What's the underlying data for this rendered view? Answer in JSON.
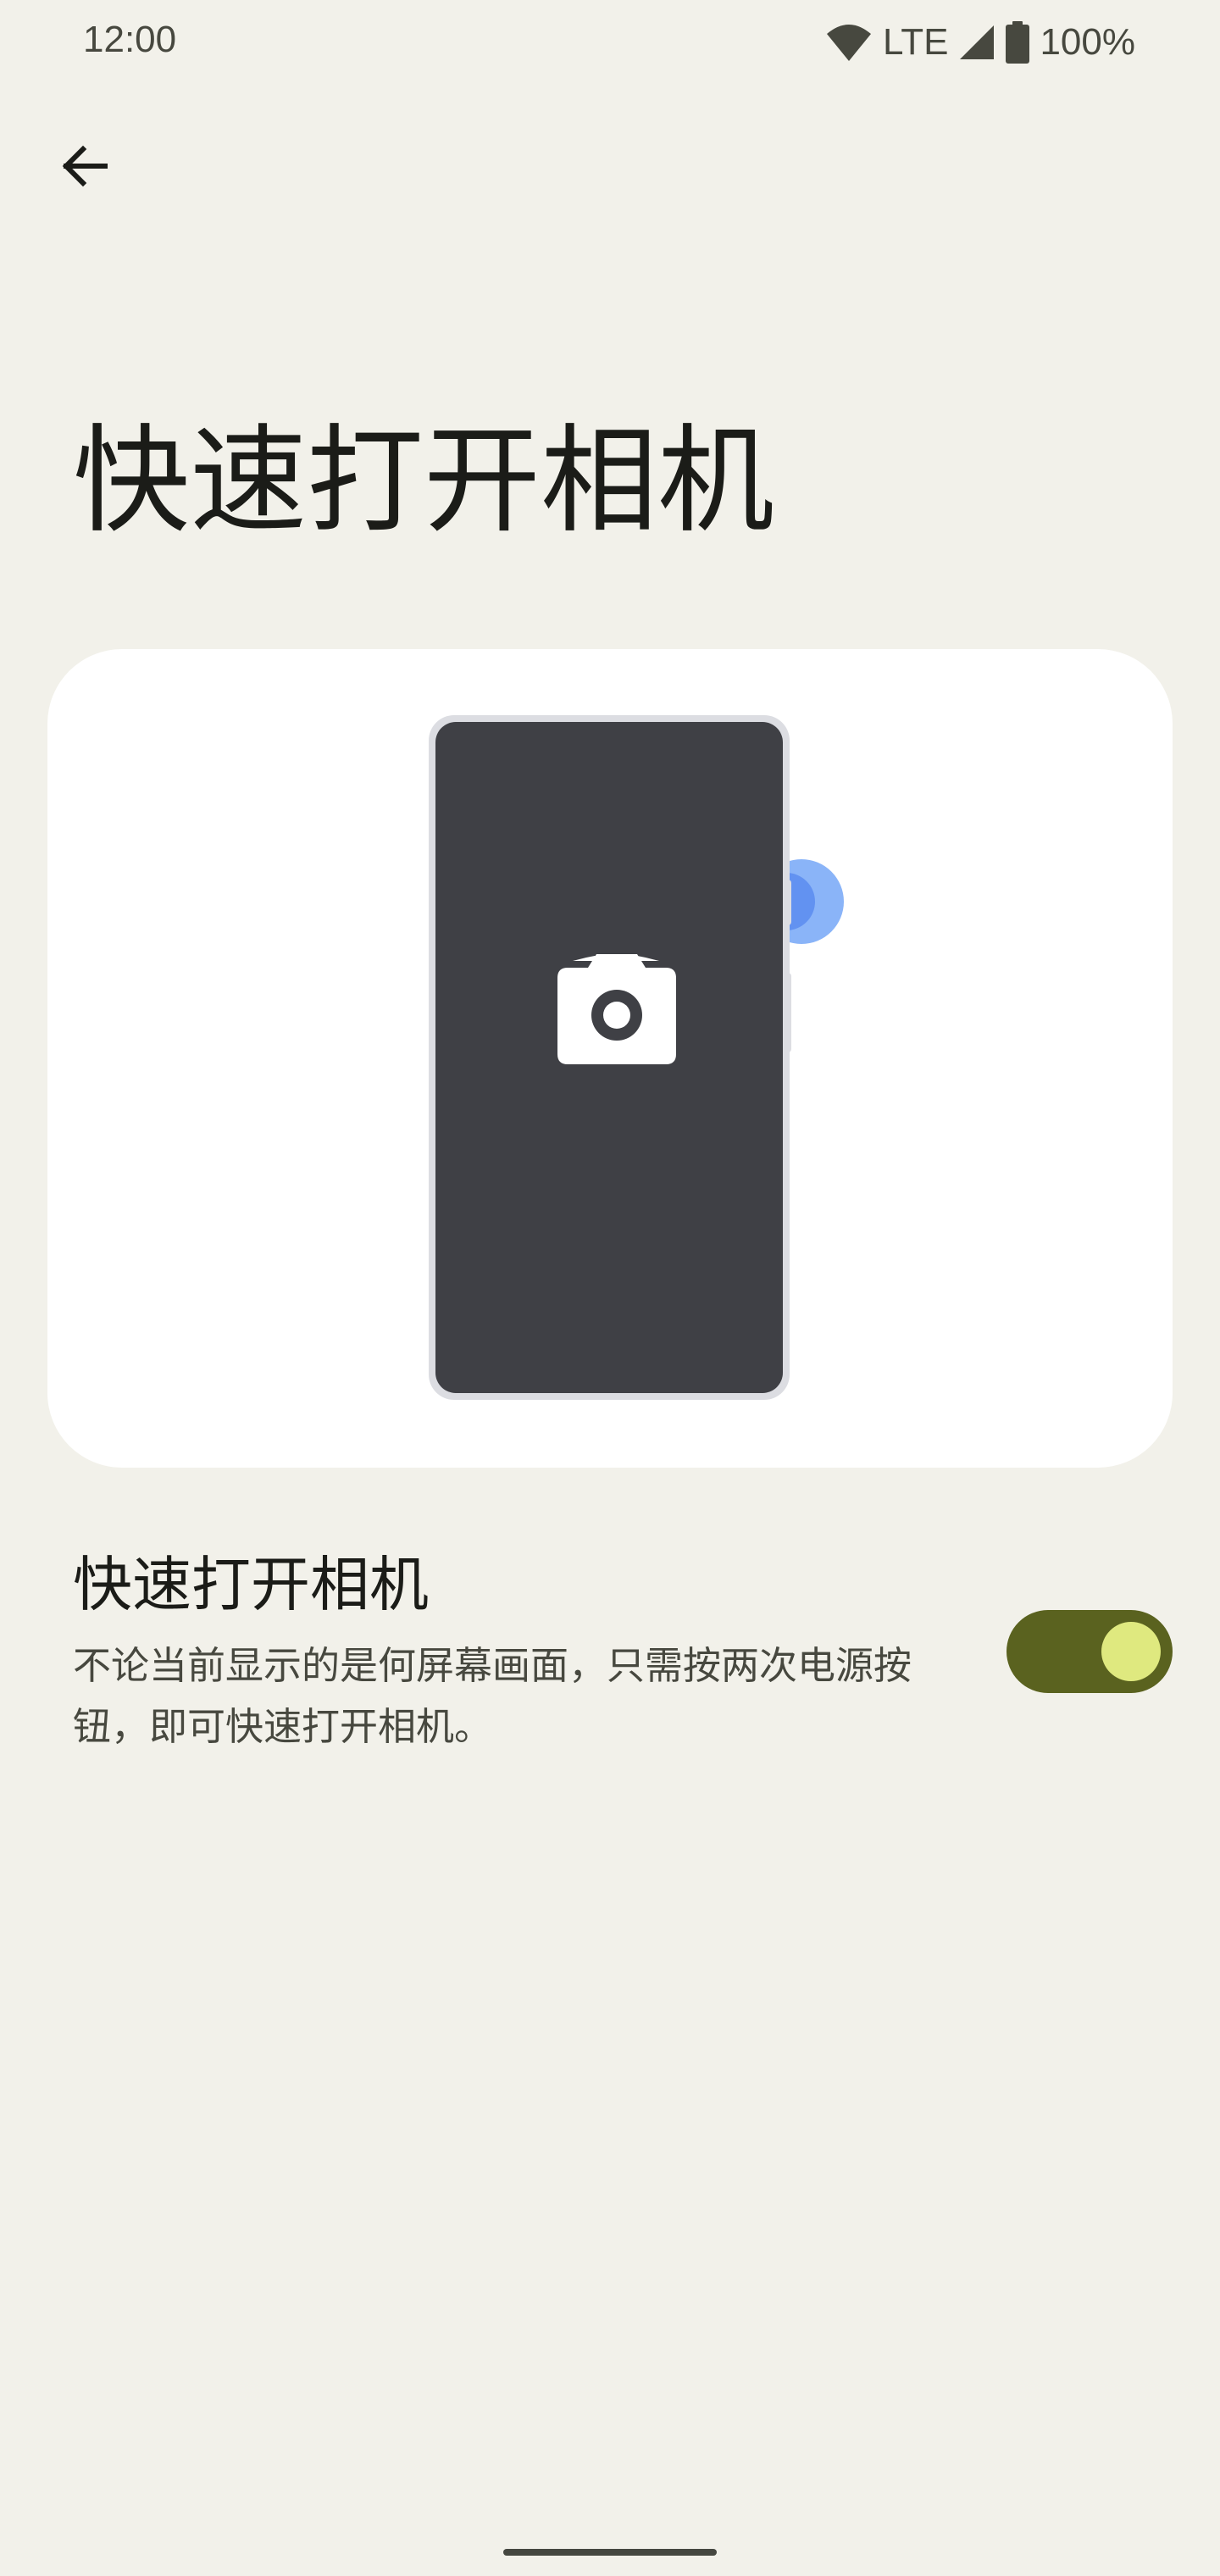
{
  "status_bar": {
    "time": "12:00",
    "network": "LTE",
    "battery": "100%",
    "icons": [
      "wifi-icon",
      "cell-signal-icon",
      "battery-icon"
    ]
  },
  "nav": {
    "back_icon": "arrow-back-icon"
  },
  "page": {
    "title": "快速打开相机"
  },
  "illustration": {
    "screen_icon": "camera-icon",
    "colors": {
      "card": "#ffffff",
      "phone_frame": "#dcdde2",
      "phone_screen": "#3f4045",
      "button_pulse": "#8ab4f8",
      "button_pulse_inner": "#5a8cf0"
    }
  },
  "setting": {
    "title": "快速打开相机",
    "summary": "不论当前显示的是何屏幕画面，只需按两次电源按钮，即可快速打开相机。",
    "enabled": true
  },
  "colors": {
    "background": "#f2f1ea",
    "toggle_track": "#5a621f",
    "toggle_thumb": "#dfe97f",
    "text_primary": "#1b1c18",
    "text_secondary": "#47483f"
  }
}
